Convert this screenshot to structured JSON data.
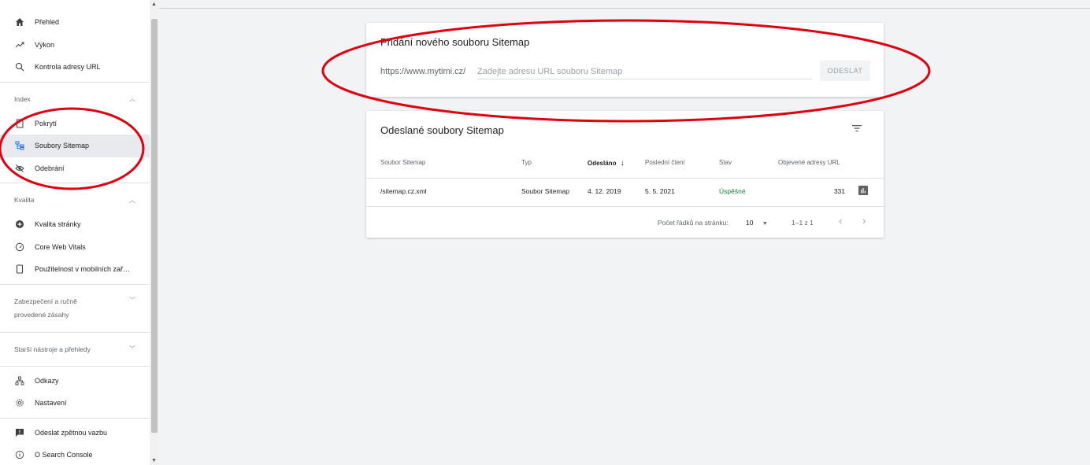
{
  "sidebar": {
    "top_items": [
      {
        "label": "Přehled",
        "icon": "home-icon"
      },
      {
        "label": "Výkon",
        "icon": "trending-up-icon"
      },
      {
        "label": "Kontrola adresy URL",
        "icon": "search-icon"
      }
    ],
    "index_section": {
      "label": "Index",
      "items": [
        {
          "label": "Pokrytí",
          "icon": "file-icon"
        },
        {
          "label": "Soubory Sitemap",
          "icon": "sitemap-icon"
        },
        {
          "label": "Odebrání",
          "icon": "eye-off-icon"
        }
      ]
    },
    "quality_section": {
      "label": "Kvalita",
      "items": [
        {
          "label": "Kvalita stránky",
          "icon": "add-circle-icon"
        },
        {
          "label": "Core Web Vitals",
          "icon": "speed-icon"
        },
        {
          "label": "Použitelnost v mobilních zař…",
          "icon": "phone-icon"
        }
      ]
    },
    "security_section": {
      "label_line1": "Zabezpečení a ručně",
      "label_line2": "provedené zásahy"
    },
    "legacy_section": {
      "label": "Starší nástroje a přehledy"
    },
    "bottom_items": [
      {
        "label": "Odkazy",
        "icon": "links-icon"
      },
      {
        "label": "Nastavení",
        "icon": "gear-icon"
      }
    ],
    "footer_items": [
      {
        "label": "Odeslat zpětnou vazbu",
        "icon": "feedback-icon"
      },
      {
        "label": "O Search Console",
        "icon": "info-icon"
      }
    ]
  },
  "add_sitemap": {
    "title": "Přidání nového souboru Sitemap",
    "prefix": "https://www.mytimi.cz/",
    "placeholder": "Zadejte adresu URL souboru Sitemap",
    "submit_label": "ODESLAT"
  },
  "submitted": {
    "title": "Odeslané soubory Sitemap",
    "columns": [
      "Soubor Sitemap",
      "Typ",
      "Odesláno",
      "Poslední čtení",
      "Stav",
      "Objevené adresy URL"
    ],
    "sort_arrow": "↓",
    "rows": [
      {
        "file": "/sitemap.cz.xml",
        "type": "Soubor Sitemap",
        "submitted": "4. 12. 2019",
        "last_read": "5. 5. 2021",
        "status": "Úspěšné",
        "urls": "331"
      }
    ],
    "pagination": {
      "rows_per_page_label": "Počet řádků na stránku:",
      "rows_per_page": "10",
      "range": "1–1 z 1",
      "prev": "‹",
      "next": "›"
    }
  },
  "colors": {
    "success": "#188038",
    "annotation": "#e0000f",
    "active_bg": "#e8eaed"
  }
}
